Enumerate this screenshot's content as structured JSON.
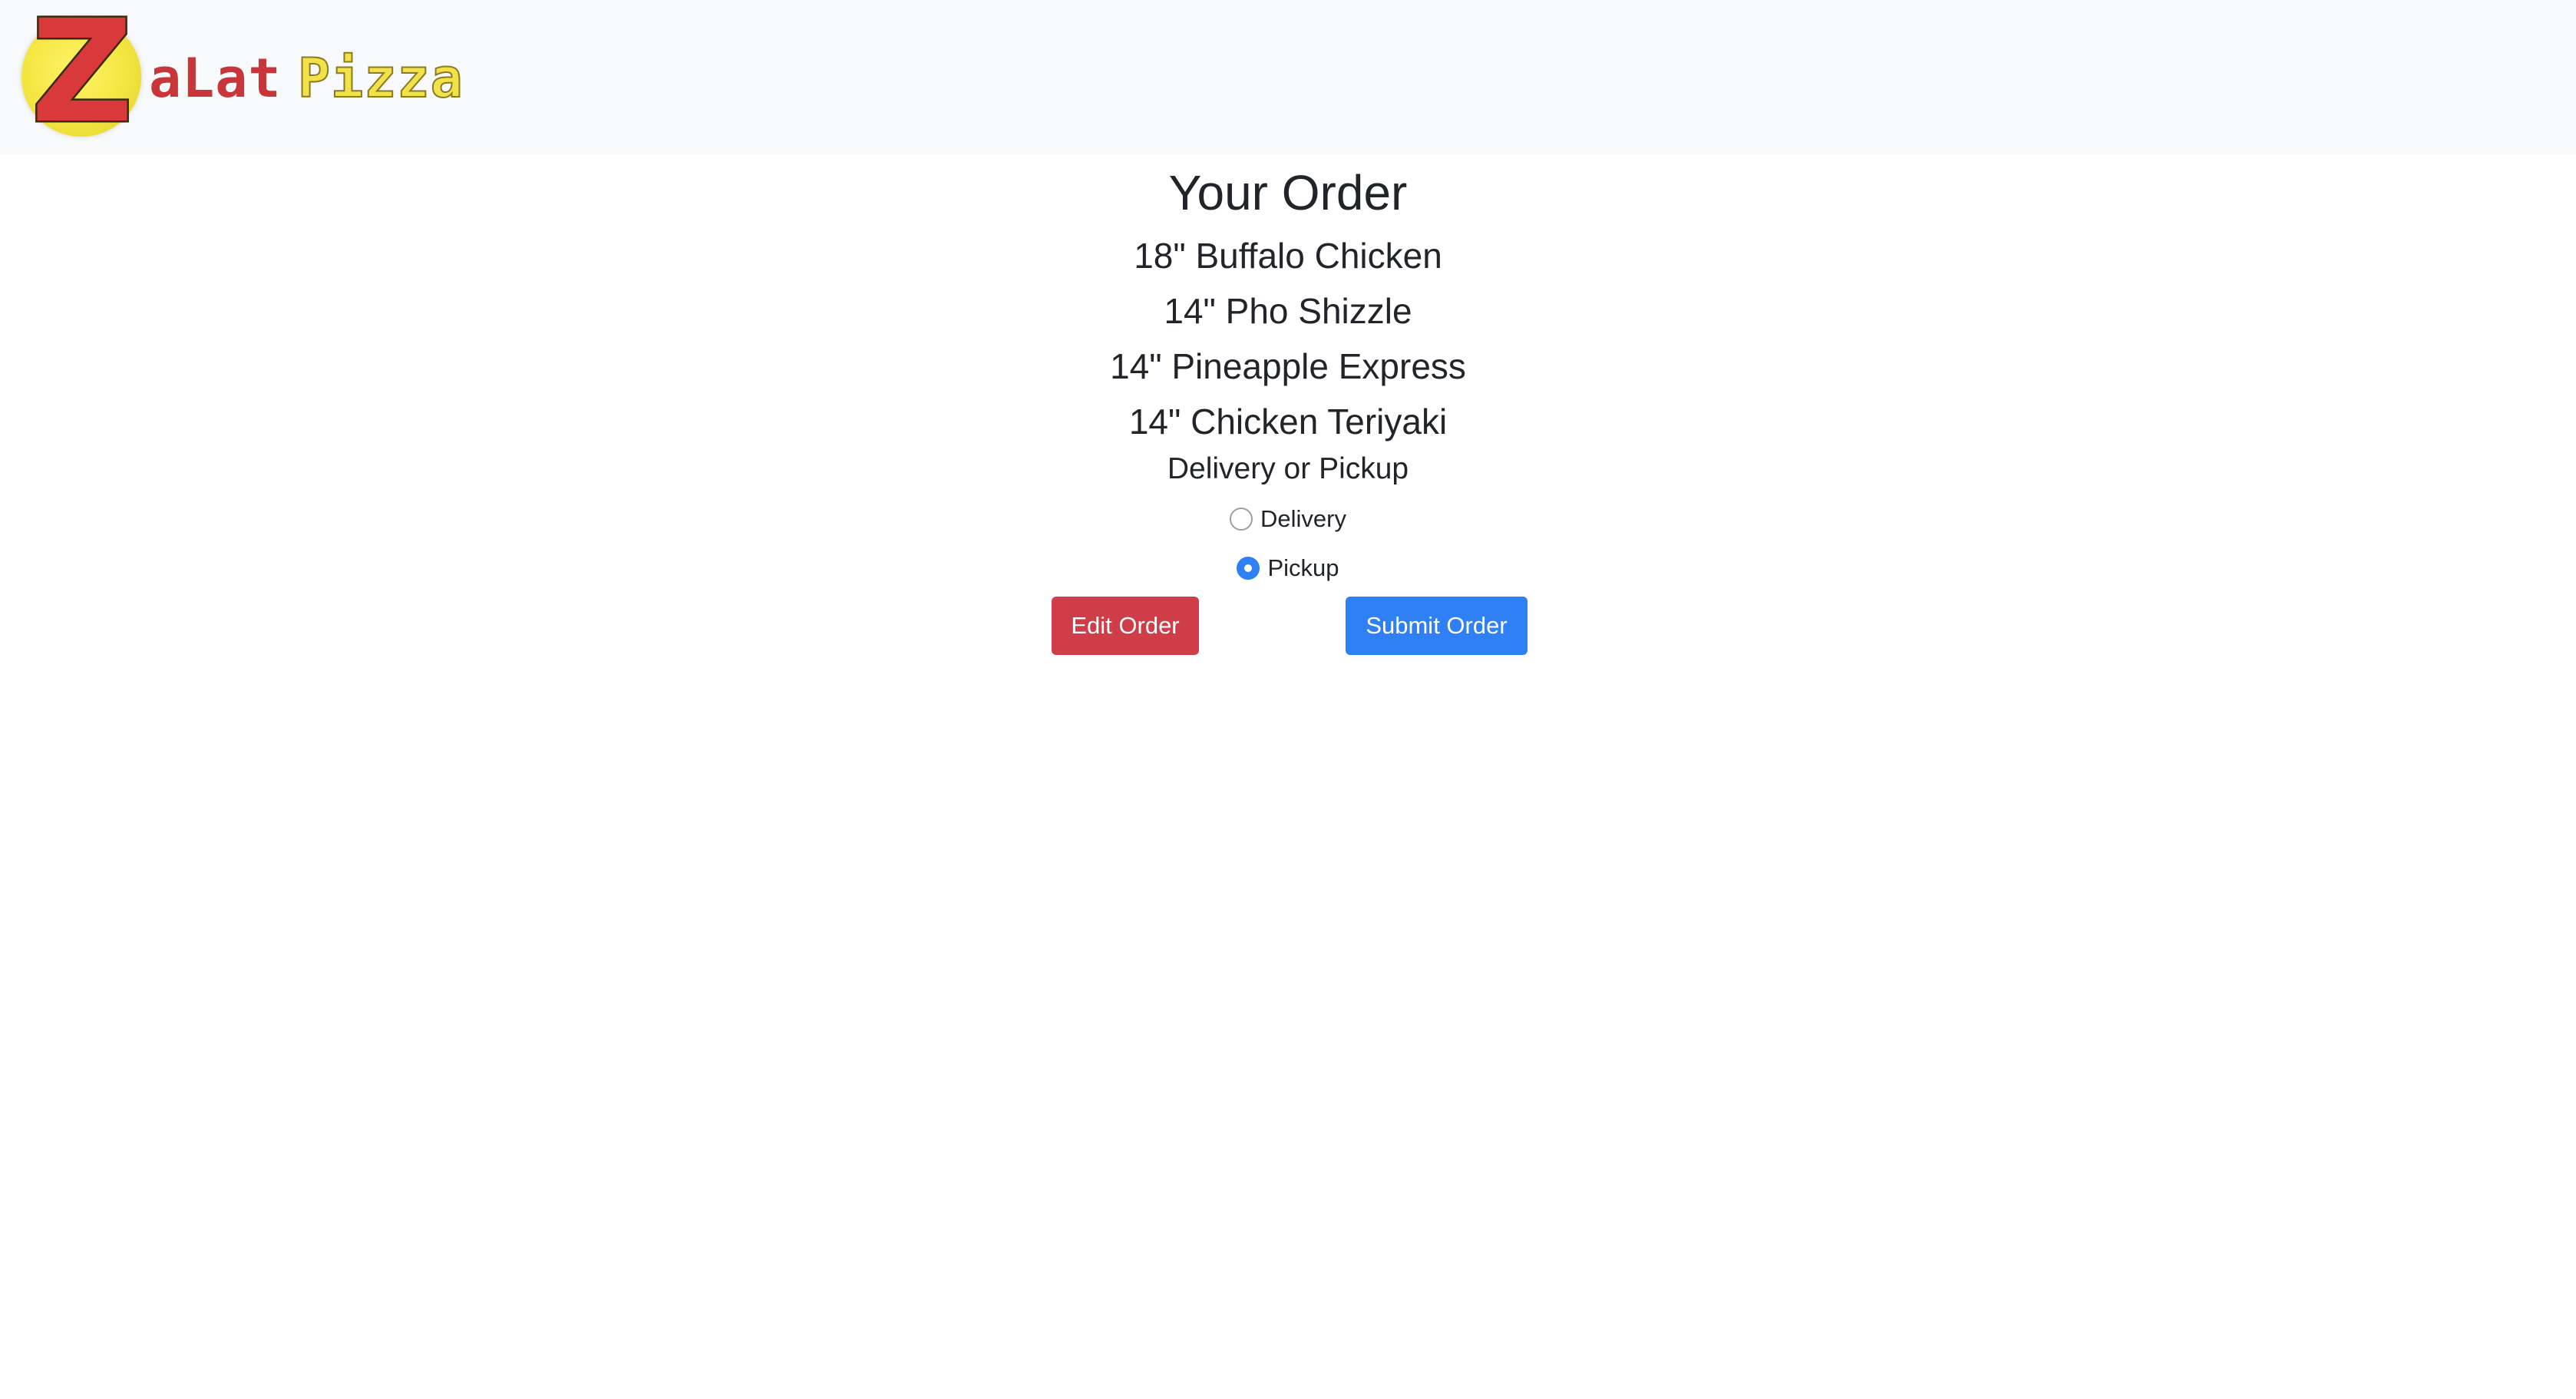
{
  "brand": {
    "logo_initial": "Z",
    "logo_word1": "aLat",
    "logo_word2": "Pizza",
    "colors": {
      "red": "#d9393a",
      "yellow": "#f1e24a"
    }
  },
  "page": {
    "title": "Your Order"
  },
  "order": {
    "items": [
      "18\" Buffalo Chicken",
      "14\" Pho Shizzle",
      "14\" Pineapple Express",
      "14\" Chicken Teriyaki"
    ]
  },
  "fulfillment": {
    "label": "Delivery or Pickup",
    "options": [
      {
        "label": "Delivery",
        "selected": false
      },
      {
        "label": "Pickup",
        "selected": true
      }
    ]
  },
  "actions": {
    "edit_label": "Edit Order",
    "submit_label": "Submit Order",
    "colors": {
      "edit": "#cf3d48",
      "submit": "#2f7ff5"
    }
  }
}
